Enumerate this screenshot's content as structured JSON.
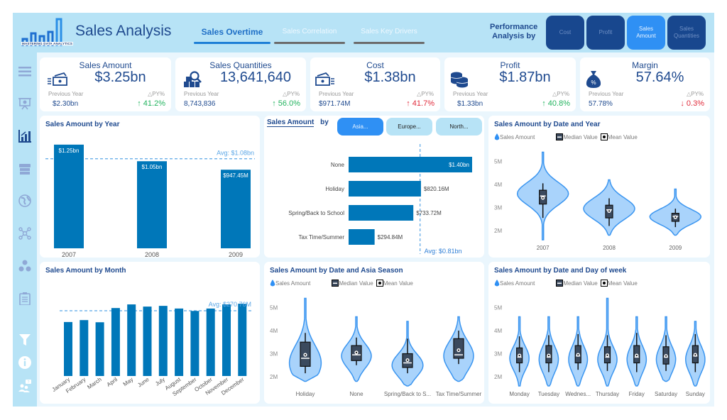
{
  "header": {
    "logo_text": "MASTERING DATA ANALYTICS",
    "title": "Sales Analysis",
    "tabs": [
      {
        "label": "Sales Overtime",
        "active": true
      },
      {
        "label": "Sales Correlation",
        "active": false
      },
      {
        "label": "Sales Key Drivers",
        "active": false
      }
    ],
    "performance_label_1": "Performance",
    "performance_label_2": "Analysis by",
    "performance_buttons": [
      {
        "label": "Cost",
        "active": false
      },
      {
        "label": "Profit",
        "active": false
      },
      {
        "label": "Sales Amount",
        "active": true
      },
      {
        "label": "Sales Quantities",
        "active": false
      }
    ]
  },
  "sidebar": {
    "items": [
      {
        "icon": "hamburger-menu-icon",
        "active": false
      },
      {
        "icon": "presentation-icon",
        "active": false
      },
      {
        "icon": "bar-chart-icon",
        "active": true
      },
      {
        "icon": "store-icon",
        "active": false
      },
      {
        "icon": "globe-icon",
        "active": false
      },
      {
        "icon": "network-icon",
        "active": false
      },
      {
        "icon": "cubes-icon",
        "active": false
      },
      {
        "icon": "clipboard-icon",
        "active": false
      },
      {
        "icon": "filter-icon",
        "active": false
      },
      {
        "icon": "info-icon",
        "active": false
      },
      {
        "icon": "help-users-icon",
        "active": false
      }
    ]
  },
  "kpis": [
    {
      "title": "Sales Amount",
      "icon": "cash-icon",
      "value": "$3.25bn",
      "prev_label": "Previous Year",
      "prev_value": "$2.30bn",
      "delta_label": "△PY%",
      "delta": "↑ 41.2%",
      "delta_color": "#22b35e"
    },
    {
      "title": "Sales Quantities",
      "icon": "boxes-search-icon",
      "value": "13,641,640",
      "prev_label": "Previous Year",
      "prev_value": "8,743,836",
      "delta_label": "△PY%",
      "delta": "↑ 56.0%",
      "delta_color": "#22b35e"
    },
    {
      "title": "Cost",
      "icon": "cash-out-icon",
      "value": "$1.38bn",
      "prev_label": "Previous Year",
      "prev_value": "$971.74M",
      "delta_label": "△PY%",
      "delta": "↑ 41.7%",
      "delta_color": "#e02b3b"
    },
    {
      "title": "Profit",
      "icon": "coins-icon",
      "value": "$1.87bn",
      "prev_label": "Previous Year",
      "prev_value": "$1.33bn",
      "delta_label": "△PY%",
      "delta": "↑ 40.8%",
      "delta_color": "#22b35e"
    },
    {
      "title": "Margin",
      "icon": "money-bag-percent-icon",
      "value": "57.64%",
      "prev_label": "Previous Year",
      "prev_value": "57.78%",
      "delta_label": "△PY%",
      "delta": "↓ 0.3%",
      "delta_color": "#e02b3b"
    }
  ],
  "season_panel": {
    "title_part1": "Sales Amount",
    "title_part2": "by",
    "slicers": [
      {
        "label": "Asia...",
        "active": true
      },
      {
        "label": "Europe...",
        "active": false
      },
      {
        "label": "North...",
        "active": false
      }
    ]
  },
  "legend": {
    "sales_amount": "Sales Amount",
    "median": "Median Value",
    "mean": "Mean Value"
  },
  "colors": {
    "bar": "#0077b9",
    "avg_line": "#5aa6e6",
    "violin_fill": "#a9d3fb",
    "violin_stroke": "#3a95f0",
    "box": "#3b4a5e",
    "title": "#1f4a8f",
    "accent": "#2f90f4"
  },
  "chart_data": [
    {
      "id": "year",
      "type": "bar",
      "title": "Sales Amount by Year",
      "categories": [
        "2007",
        "2008",
        "2009"
      ],
      "values": [
        1250,
        1050,
        947.45
      ],
      "data_labels": [
        "$1.25bn",
        "$1.05bn",
        "$947.45M"
      ],
      "unit": "USD millions",
      "average": 1080,
      "average_label": "Avg: $1.08bn",
      "ylim": [
        0,
        1300
      ]
    },
    {
      "id": "season",
      "type": "bar",
      "orientation": "horizontal",
      "title": "Sales Amount by Season (Asia)",
      "categories": [
        "None",
        "Holiday",
        "Spring/Back to School",
        "Tax Time/Summer"
      ],
      "values": [
        1400,
        820.16,
        733.72,
        294.84
      ],
      "data_labels": [
        "$1.40bn",
        "$820.16M",
        "$733.72M",
        "$294.84M"
      ],
      "unit": "USD millions",
      "average": 810,
      "average_label": "Avg: $0.81bn",
      "xlim": [
        0,
        1400
      ]
    },
    {
      "id": "violin_year",
      "type": "violin",
      "title": "Sales Amount by Date and Year",
      "categories": [
        "2007",
        "2008",
        "2009"
      ],
      "yticks": [
        "2M",
        "3M",
        "4M",
        "5M"
      ],
      "ylim": [
        1.6,
        5.6
      ],
      "series": [
        {
          "name": "2007",
          "min": 1.6,
          "max": 5.4,
          "whisker_low": 2.55,
          "whisker_high": 4.05,
          "q1": 3.15,
          "q3": 3.75,
          "median": 3.5,
          "mean": 3.42,
          "peak": 3.6,
          "width": 1.0
        },
        {
          "name": "2008",
          "min": 1.8,
          "max": 4.2,
          "whisker_low": 2.2,
          "whisker_high": 3.4,
          "q1": 2.55,
          "q3": 3.1,
          "median": 2.9,
          "mean": 2.85,
          "peak": 2.95,
          "width": 1.0
        },
        {
          "name": "2009",
          "min": 1.8,
          "max": 3.8,
          "whisker_low": 2.15,
          "whisker_high": 2.95,
          "q1": 2.4,
          "q3": 2.75,
          "median": 2.62,
          "mean": 2.58,
          "peak": 2.6,
          "width": 1.0
        }
      ]
    },
    {
      "id": "month",
      "type": "bar",
      "title": "Sales Amount by Month",
      "categories": [
        "January",
        "February",
        "March",
        "April",
        "May",
        "June",
        "July",
        "August",
        "September",
        "October",
        "November",
        "December"
      ],
      "values": [
        224,
        232,
        223,
        282,
        297,
        288,
        291,
        280,
        270,
        280,
        297,
        300
      ],
      "unit": "USD millions",
      "average": 270.76,
      "average_label": "Avg: $270.76M",
      "ylim": [
        0,
        310
      ]
    },
    {
      "id": "violin_season",
      "type": "violin",
      "title": "Sales Amount by Date and Asia Season",
      "categories": [
        "Holiday",
        "None",
        "Spring/Back to S...",
        "Tax Time/Summer"
      ],
      "yticks": [
        "2M",
        "3M",
        "4M",
        "5M"
      ],
      "ylim": [
        1.6,
        5.6
      ],
      "series": [
        {
          "name": "Holiday",
          "min": 1.8,
          "max": 5.4,
          "whisker_low": 2.15,
          "whisker_high": 3.9,
          "q1": 2.45,
          "q3": 3.5,
          "median": 2.8,
          "mean": 2.95,
          "peak": 2.6,
          "width": 0.8
        },
        {
          "name": "None",
          "min": 1.8,
          "max": 4.6,
          "whisker_low": 2.5,
          "whisker_high": 3.7,
          "q1": 2.7,
          "q3": 3.35,
          "median": 2.95,
          "mean": 3.05,
          "peak": 2.9,
          "width": 0.75
        },
        {
          "name": "Spring/Back to School",
          "min": 1.6,
          "max": 4.4,
          "whisker_low": 2.15,
          "whisker_high": 3.65,
          "q1": 2.4,
          "q3": 3.0,
          "median": 2.6,
          "mean": 2.72,
          "peak": 2.5,
          "width": 0.78
        },
        {
          "name": "Tax Time/Summer",
          "min": 1.8,
          "max": 4.6,
          "whisker_low": 2.55,
          "whisker_high": 4.0,
          "q1": 2.8,
          "q3": 3.65,
          "median": 2.95,
          "mean": 3.15,
          "peak": 2.9,
          "width": 0.75
        }
      ]
    },
    {
      "id": "violin_dow",
      "type": "violin",
      "title": "Sales Amount by Date and Day of week",
      "categories": [
        "Monday",
        "Tuesday",
        "Wednes...",
        "Thursday",
        "Friday",
        "Saturday",
        "Sunday"
      ],
      "yticks": [
        "2M",
        "3M",
        "4M",
        "5M"
      ],
      "ylim": [
        1.6,
        5.6
      ],
      "series": [
        {
          "name": "Monday",
          "min": 1.6,
          "max": 4.6,
          "whisker_low": 2.2,
          "whisker_high": 3.75,
          "q1": 2.6,
          "q3": 3.25,
          "median": 2.85,
          "mean": 2.92,
          "peak": 2.8,
          "width": 0.8
        },
        {
          "name": "Tuesday",
          "min": 1.6,
          "max": 4.6,
          "whisker_low": 2.2,
          "whisker_high": 3.8,
          "q1": 2.6,
          "q3": 3.35,
          "median": 2.85,
          "mean": 2.92,
          "peak": 2.75,
          "width": 0.8
        },
        {
          "name": "Wednesday",
          "min": 1.6,
          "max": 4.6,
          "whisker_low": 2.3,
          "whisker_high": 3.85,
          "q1": 2.6,
          "q3": 3.35,
          "median": 2.9,
          "mean": 2.95,
          "peak": 2.75,
          "width": 0.78
        },
        {
          "name": "Thursday",
          "min": 1.6,
          "max": 5.4,
          "whisker_low": 2.25,
          "whisker_high": 3.8,
          "q1": 2.6,
          "q3": 3.3,
          "median": 2.85,
          "mean": 2.93,
          "peak": 2.75,
          "width": 0.8
        },
        {
          "name": "Friday",
          "min": 1.6,
          "max": 4.6,
          "whisker_low": 2.2,
          "whisker_high": 3.9,
          "q1": 2.6,
          "q3": 3.35,
          "median": 2.85,
          "mean": 2.92,
          "peak": 2.75,
          "width": 0.8
        },
        {
          "name": "Saturday",
          "min": 1.8,
          "max": 4.6,
          "whisker_low": 2.25,
          "whisker_high": 3.8,
          "q1": 2.55,
          "q3": 3.3,
          "median": 2.85,
          "mean": 2.9,
          "peak": 2.75,
          "width": 0.8
        },
        {
          "name": "Sunday",
          "min": 1.6,
          "max": 4.4,
          "whisker_low": 2.2,
          "whisker_high": 3.85,
          "q1": 2.6,
          "q3": 3.35,
          "median": 2.9,
          "mean": 2.95,
          "peak": 2.75,
          "width": 0.8
        }
      ]
    }
  ]
}
